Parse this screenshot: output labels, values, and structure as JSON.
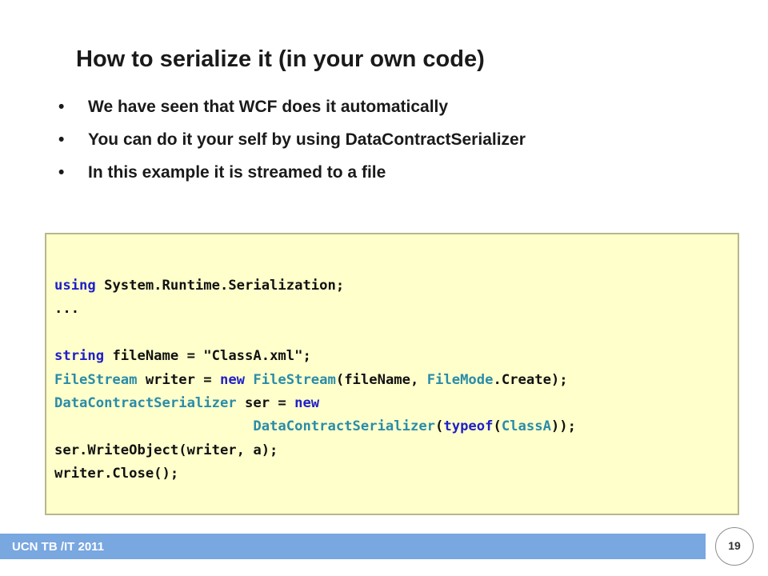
{
  "slide": {
    "title": "How to serialize it (in your own code)",
    "bullets": [
      "We have seen that WCF does it automatically",
      "You can do it your self by using  DataContractSerializer",
      "In this example it is streamed to a file"
    ],
    "bullet_symbol": "•"
  },
  "code": {
    "lines": [
      [
        {
          "t": "using",
          "c": "kw"
        },
        {
          "t": " System.Runtime.Serialization;"
        }
      ],
      [
        {
          "t": "..."
        }
      ],
      [
        {
          "t": ""
        }
      ],
      [
        {
          "t": "string",
          "c": "kw"
        },
        {
          "t": " fileName = "
        },
        {
          "t": "\"ClassA.xml\"",
          "c": "str"
        },
        {
          "t": ";"
        }
      ],
      [
        {
          "t": "FileStream",
          "c": "ty"
        },
        {
          "t": " writer = "
        },
        {
          "t": "new",
          "c": "kw"
        },
        {
          "t": " "
        },
        {
          "t": "FileStream",
          "c": "ty"
        },
        {
          "t": "(fileName, "
        },
        {
          "t": "FileMode",
          "c": "ty"
        },
        {
          "t": ".Create);"
        }
      ],
      [
        {
          "t": "DataContractSerializer",
          "c": "ty"
        },
        {
          "t": " ser = "
        },
        {
          "t": "new",
          "c": "kw"
        }
      ],
      [
        {
          "t": "                        "
        },
        {
          "t": "DataContractSerializer",
          "c": "ty"
        },
        {
          "t": "("
        },
        {
          "t": "typeof",
          "c": "kw"
        },
        {
          "t": "("
        },
        {
          "t": "ClassA",
          "c": "ty"
        },
        {
          "t": "));"
        }
      ],
      [
        {
          "t": "ser.WriteObject(writer, a);"
        }
      ],
      [
        {
          "t": "writer.Close();"
        }
      ]
    ]
  },
  "footer": {
    "label": "UCN TB /IT 2011",
    "page_number": "19"
  },
  "colors": {
    "code_background": "#ffffcc",
    "keyword": "#2020c8",
    "type": "#2a8ca8",
    "footer_bar": "#79a7e0"
  }
}
